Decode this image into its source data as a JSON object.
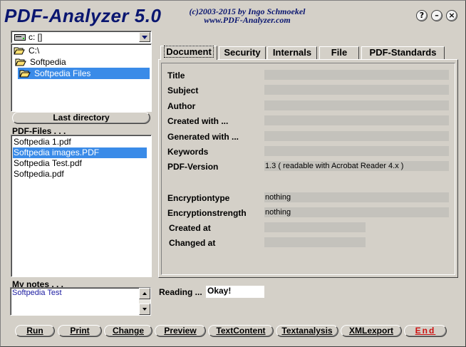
{
  "app": {
    "title": "PDF-Analyzer 5.0",
    "copyright_line1": "(c)2003-2015 by Ingo Schmoekel",
    "copyright_line2": "www.PDF-Analyzer.com"
  },
  "window_buttons": {
    "help": "?",
    "minimize": "–",
    "close": "×"
  },
  "drive": {
    "value": "c: []"
  },
  "directories": [
    {
      "label": "C:\\",
      "selected": false
    },
    {
      "label": "Softpedia",
      "selected": false
    },
    {
      "label": "Softpedia Files",
      "selected": true
    }
  ],
  "last_directory_button": "Last directory",
  "pdf_files_label": "PDF-Files . . .",
  "files": [
    {
      "name": "Softpedia 1.pdf",
      "selected": false
    },
    {
      "name": "Softpedia images.PDF",
      "selected": true
    },
    {
      "name": "Softpedia Test.pdf",
      "selected": false
    },
    {
      "name": "Softpedia.pdf",
      "selected": false
    }
  ],
  "notes": {
    "label": "My notes . . .",
    "text": "Softpedia Test"
  },
  "tabs": [
    {
      "label": "Document",
      "active": true
    },
    {
      "label": "Security",
      "active": false
    },
    {
      "label": "Internals",
      "active": false
    },
    {
      "label": "File",
      "active": false
    },
    {
      "label": "PDF-Standards",
      "active": false
    }
  ],
  "document_fields": [
    {
      "label": "Title",
      "value": ""
    },
    {
      "label": "Subject",
      "value": ""
    },
    {
      "label": "Author",
      "value": ""
    },
    {
      "label": "Created with ...",
      "value": ""
    },
    {
      "label": "Generated with ...",
      "value": ""
    },
    {
      "label": "Keywords",
      "value": ""
    },
    {
      "label": "PDF-Version",
      "value": "1.3  ( readable with Acrobat Reader 4.x )"
    },
    {
      "label": "Encryptiontype",
      "value": "nothing"
    },
    {
      "label": "Encryptionstrength",
      "value": "nothing"
    },
    {
      "label": "Created at",
      "value": ""
    },
    {
      "label": "Changed at",
      "value": ""
    }
  ],
  "reading": {
    "label": "Reading ...",
    "value": "Okay!"
  },
  "bottom_buttons": {
    "run": "Run",
    "print": "Print",
    "change": "Change",
    "preview": "Preview",
    "textcontent": "TextContent",
    "textanalysis": "Textanalysis",
    "xmlexport": "XMLexport",
    "end": "End"
  },
  "colors": {
    "title": "#0a1670",
    "selection": "#3a8be8",
    "end_button": "#cc1010",
    "notes_text": "#1a1aa0",
    "field_background": "#c4c2bc"
  }
}
